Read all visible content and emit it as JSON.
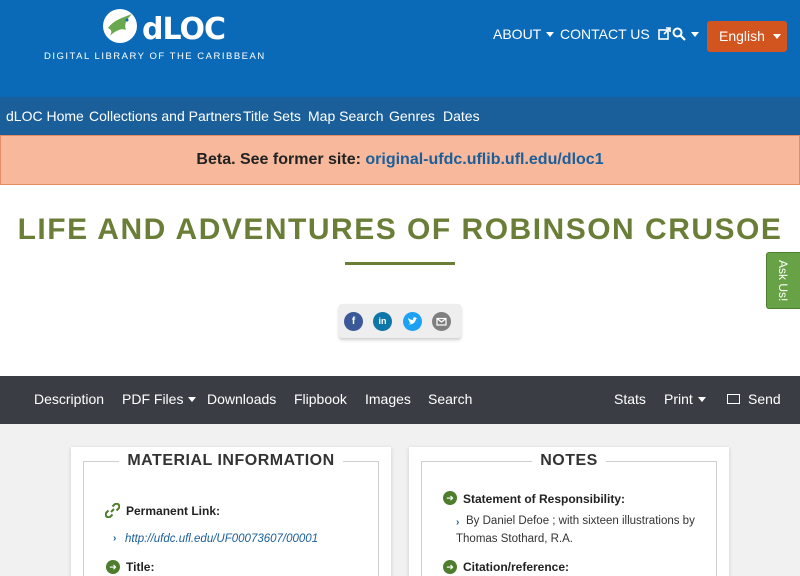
{
  "header": {
    "logo_text": "dLOC",
    "logo_subtitle": "DIGITAL LIBRARY OF THE CARIBBEAN",
    "nav": {
      "about": "ABOUT",
      "contact": "CONTACT US"
    },
    "language": "English",
    "colors": {
      "header_bg": "#0a6ab8",
      "language_button": "#d2541f"
    }
  },
  "main_nav": [
    "dLOC Home",
    "Collections and Partners",
    "Title Sets",
    "Map Search",
    "Genres",
    "Dates"
  ],
  "beta_banner": {
    "text": "Beta. See former site:",
    "link": "original-ufdc.uflib.ufl.edu/dloc1"
  },
  "page_title": "LIFE AND ADVENTURES OF ROBINSON CRUSOE",
  "share_icons": [
    "facebook-icon",
    "linkedin-icon",
    "twitter-icon",
    "email-icon"
  ],
  "ask_us": "Ask Us!",
  "item_nav": {
    "left": [
      "Description",
      "PDF Files",
      "Downloads",
      "Flipbook",
      "Images",
      "Search"
    ],
    "stats": "Stats",
    "print": "Print",
    "send": "Send"
  },
  "material_info": {
    "heading": "MATERIAL INFORMATION",
    "permanent_link_label": "Permanent Link:",
    "permanent_link": "http://ufdc.ufl.edu/UF00073607/00001",
    "title_label": "Title:"
  },
  "notes": {
    "heading": "NOTES",
    "statement_label": "Statement of Responsibility:",
    "statement_value": "By Daniel Defoe ; with sixteen illustrations by Thomas Stothard, R.A.",
    "citation_label": "Citation/reference:"
  }
}
